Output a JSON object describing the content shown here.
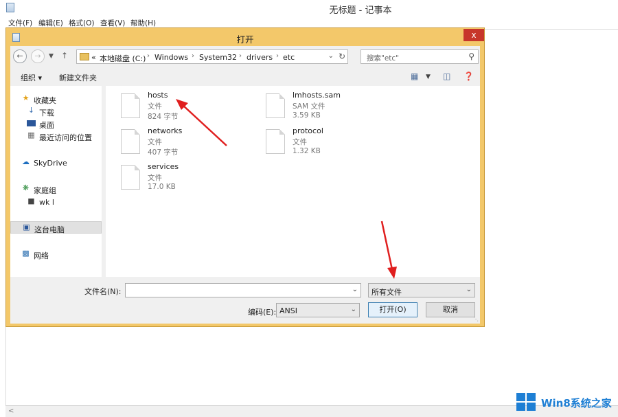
{
  "notepad": {
    "title": "无标题 - 记事本",
    "menus": [
      "文件(F)",
      "编辑(E)",
      "格式(O)",
      "查看(V)",
      "帮助(H)"
    ]
  },
  "dialog": {
    "title": "打开",
    "close_label": "x",
    "address": {
      "overflow": "«",
      "crumbs": [
        "本地磁盘 (C:)",
        "Windows",
        "System32",
        "drivers",
        "etc"
      ]
    },
    "search_placeholder": "搜索\"etc\"",
    "toolbar": {
      "organize": "组织 ▾",
      "new_folder": "新建文件夹"
    },
    "nav": {
      "favorites": "收藏夹",
      "downloads": "下载",
      "desktop": "桌面",
      "recent": "最近访问的位置",
      "skydrive": "SkyDrive",
      "homegroup": "家庭组",
      "user": "wk l",
      "thispc": "这台电脑",
      "network": "网络"
    },
    "files": [
      {
        "name": "hosts",
        "type": "文件",
        "size": "824 字节"
      },
      {
        "name": "networks",
        "type": "文件",
        "size": "407 字节"
      },
      {
        "name": "services",
        "type": "文件",
        "size": "17.0 KB"
      },
      {
        "name": "lmhosts.sam",
        "type": "SAM 文件",
        "size": "3.59 KB"
      },
      {
        "name": "protocol",
        "type": "文件",
        "size": "1.32 KB"
      }
    ],
    "filename_label": "文件名(N):",
    "filename_value": "",
    "filter_value": "所有文件",
    "encoding_label": "编码(E):",
    "encoding_value": "ANSI",
    "open_button": "打开(O)",
    "cancel_button": "取消"
  },
  "watermark": "Win8系统之家",
  "colors": {
    "dialog_frame": "#f3c86a",
    "close_red": "#c7362b",
    "annotation_arrow": "#e01f1f",
    "watermark_blue": "#1e7fd4"
  }
}
